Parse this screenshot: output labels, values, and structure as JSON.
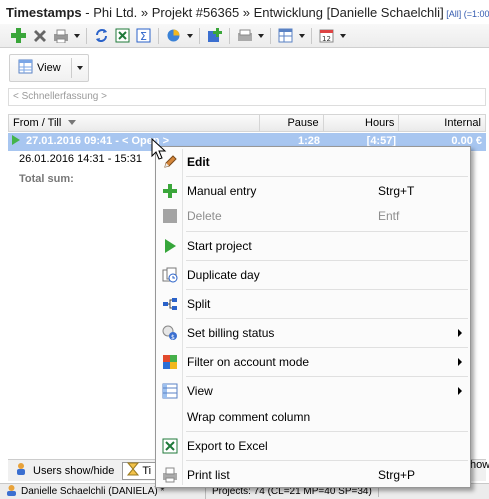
{
  "window": {
    "title_bold": "Timestamps",
    "title_rest": " - Phi Ltd. » Projekt #56365 » Entwicklung [Danielle Schaelchli]",
    "title_tag": " [All] (=1:00"
  },
  "toolbar2": {
    "view_label": "View"
  },
  "quick_entry": {
    "placeholder": "< Schnellerfassung >"
  },
  "grid": {
    "columns": [
      "From / Till",
      "Pause",
      "Hours",
      "Internal"
    ],
    "rows": [
      {
        "from": "27.01.2016   09:41 - < Open >",
        "pause": "1:28",
        "hours": "[4:57]",
        "internal": "0.00 €"
      },
      {
        "from": "26.01.2016   14:31 - 15:31"
      }
    ],
    "total_label": "Total sum:"
  },
  "context_menu": {
    "items": [
      {
        "label": "Edit",
        "shortcut": ""
      },
      {
        "label": "Manual entry",
        "shortcut": "Strg+T"
      },
      {
        "label": "Delete",
        "shortcut": "Entf"
      },
      {
        "label": "Start project",
        "shortcut": ""
      },
      {
        "label": "Duplicate day",
        "shortcut": ""
      },
      {
        "label": "Split",
        "shortcut": ""
      },
      {
        "label": "Set billing status",
        "shortcut": ""
      },
      {
        "label": "Filter on account mode",
        "shortcut": ""
      },
      {
        "label": "View",
        "shortcut": ""
      },
      {
        "label": "Wrap comment column",
        "shortcut": ""
      },
      {
        "label": "Export to Excel",
        "shortcut": ""
      },
      {
        "label": "Print list",
        "shortcut": "Strg+P"
      }
    ]
  },
  "bottom_tabs": {
    "users": "Users show/hide",
    "tab2": "Ti",
    "edge": "how"
  },
  "statusbar": {
    "user": "Danielle Schaelchli (DANIELA) *",
    "projects": "Projects: 74 (CL=21 MP=40 SP=34)"
  },
  "colors": {
    "selection": "#a8c6f0",
    "accent_blue": "#345bb0",
    "green": "#44b44a"
  }
}
